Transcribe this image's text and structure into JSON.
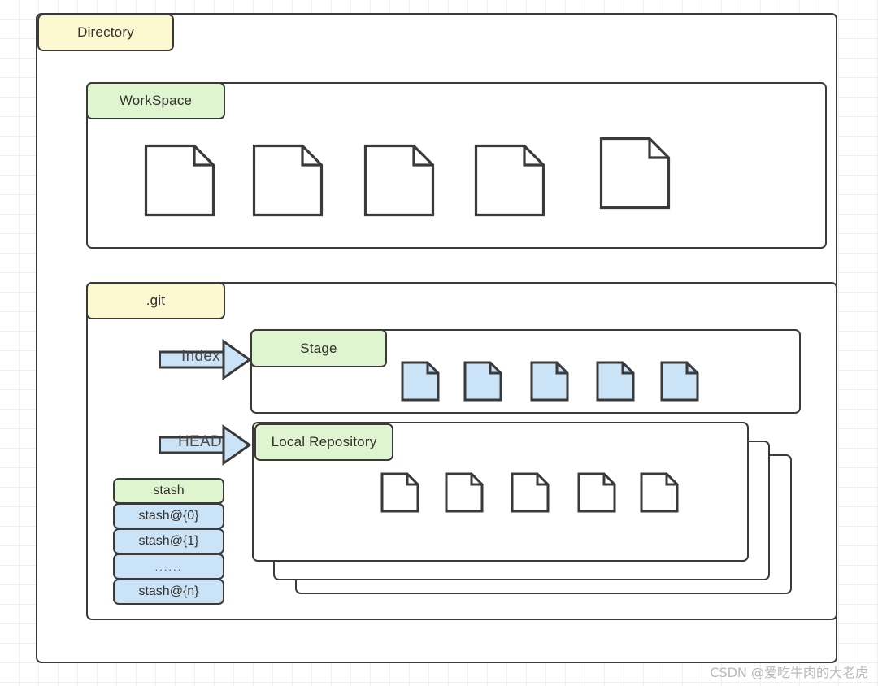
{
  "diagram": {
    "title": "Git Directory Structure",
    "background": {
      "grid": true,
      "grid_size_px": 24,
      "grid_color": "#f0f0f0"
    },
    "stroke_color": "#3a3a3a",
    "palette": {
      "yellow": "#fcf8cf",
      "green": "#dff5d0",
      "blue": "#cbe3f7",
      "white": "#ffffff"
    }
  },
  "directory": {
    "label": "Directory",
    "color": "#fcf8cf"
  },
  "workspace": {
    "label": "WorkSpace",
    "color": "#dff5d0",
    "file_count": 5,
    "file_fill": "#ffffff",
    "file_icon": "document-icon"
  },
  "git": {
    "label": ".git",
    "color": "#fcf8cf"
  },
  "index_arrow": {
    "label": "Index",
    "color": "#cbe3f7",
    "icon": "block-arrow-right-icon"
  },
  "head_arrow": {
    "label": "HEAD",
    "color": "#cbe3f7",
    "icon": "block-arrow-right-icon"
  },
  "stage": {
    "label": "Stage",
    "color": "#dff5d0",
    "file_count": 5,
    "file_fill": "#cbe3f7",
    "file_icon": "document-icon"
  },
  "local_repository": {
    "label": "Local Repository",
    "color": "#dff5d0",
    "file_count": 5,
    "file_fill": "#ffffff",
    "file_icon": "document-icon",
    "stacked_layers": 2
  },
  "stash": {
    "header": "stash",
    "header_color": "#dff5d0",
    "entry_color": "#cbe3f7",
    "entries": [
      "stash@{0}",
      "stash@{1}",
      "......",
      "stash@{n}"
    ]
  },
  "watermark": {
    "text": "CSDN @爱吃牛肉的大老虎"
  }
}
